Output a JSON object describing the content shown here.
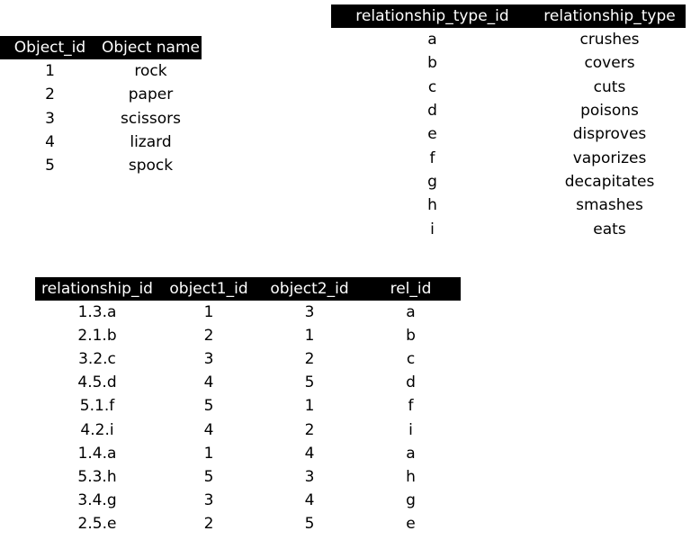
{
  "objects_table": {
    "headers": [
      "Object_id",
      "Object name"
    ],
    "rows": [
      [
        "1",
        "rock"
      ],
      [
        "2",
        "paper"
      ],
      [
        "3",
        "scissors"
      ],
      [
        "4",
        "lizard"
      ],
      [
        "5",
        "spock"
      ]
    ]
  },
  "relationship_types_table": {
    "headers": [
      "relationship_type_id",
      "relationship_type"
    ],
    "rows": [
      [
        "a",
        "crushes"
      ],
      [
        "b",
        "covers"
      ],
      [
        "c",
        "cuts"
      ],
      [
        "d",
        "poisons"
      ],
      [
        "e",
        "disproves"
      ],
      [
        "f",
        "vaporizes"
      ],
      [
        "g",
        "decapitates"
      ],
      [
        "h",
        "smashes"
      ],
      [
        "i",
        "eats"
      ]
    ]
  },
  "relationships_table": {
    "headers": [
      "relationship_id",
      "object1_id",
      "object2_id",
      "rel_id"
    ],
    "rows": [
      [
        "1.3.a",
        "1",
        "3",
        "a"
      ],
      [
        "2.1.b",
        "2",
        "1",
        "b"
      ],
      [
        "3.2.c",
        "3",
        "2",
        "c"
      ],
      [
        "4.5.d",
        "4",
        "5",
        "d"
      ],
      [
        "5.1.f",
        "5",
        "1",
        "f"
      ],
      [
        "4.2.i",
        "4",
        "2",
        "i"
      ],
      [
        "1.4.a",
        "1",
        "4",
        "a"
      ],
      [
        "5.3.h",
        "5",
        "3",
        "h"
      ],
      [
        "3.4.g",
        "3",
        "4",
        "g"
      ],
      [
        "2.5.e",
        "2",
        "5",
        "e"
      ]
    ]
  }
}
